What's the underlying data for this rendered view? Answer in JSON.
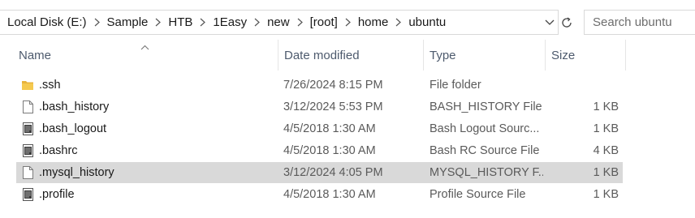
{
  "address_bar": {
    "crumbs": [
      "Local Disk (E:)",
      "Sample",
      "HTB",
      "1Easy",
      "new",
      "[root]",
      "home",
      "ubuntu"
    ]
  },
  "search": {
    "placeholder": "Search ubuntu"
  },
  "columns": {
    "name": "Name",
    "date": "Date modified",
    "type": "Type",
    "size": "Size"
  },
  "files": [
    {
      "icon": "folder-icon",
      "name": ".ssh",
      "date": "7/26/2024 8:15 PM",
      "type": "File folder",
      "size": ""
    },
    {
      "icon": "blank-file-icon",
      "name": ".bash_history",
      "date": "3/12/2024 5:53 PM",
      "type": "BASH_HISTORY File",
      "size": "1 KB"
    },
    {
      "icon": "text-file-icon",
      "name": ".bash_logout",
      "date": "4/5/2018 1:30 AM",
      "type": "Bash Logout Sourc...",
      "size": "1 KB"
    },
    {
      "icon": "text-file-icon",
      "name": ".bashrc",
      "date": "4/5/2018 1:30 AM",
      "type": "Bash RC Source File",
      "size": "4 KB"
    },
    {
      "icon": "blank-file-icon",
      "name": ".mysql_history",
      "date": "3/12/2024 4:05 PM",
      "type": "MYSQL_HISTORY F...",
      "size": "1 KB",
      "selected": true
    },
    {
      "icon": "text-file-icon",
      "name": ".profile",
      "date": "4/5/2018 1:30 AM",
      "type": "Profile Source File",
      "size": "1 KB"
    }
  ]
}
